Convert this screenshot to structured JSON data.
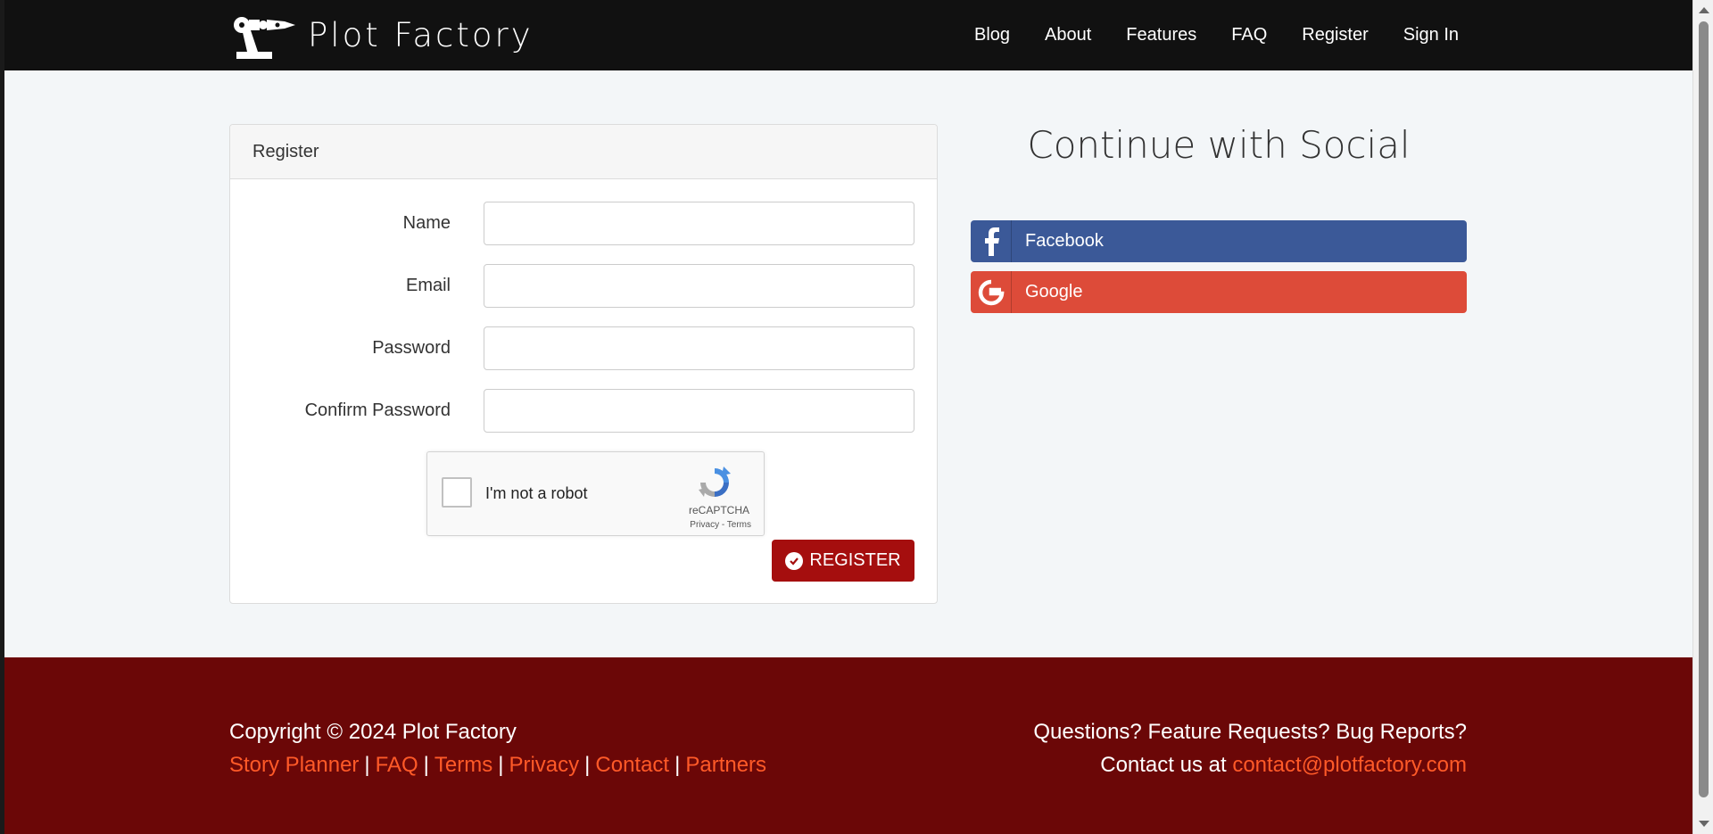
{
  "brand": {
    "name": "Plot Factory"
  },
  "nav": {
    "items": [
      {
        "label": "Blog"
      },
      {
        "label": "About"
      },
      {
        "label": "Features"
      },
      {
        "label": "FAQ"
      },
      {
        "label": "Register"
      },
      {
        "label": "Sign In"
      }
    ]
  },
  "register": {
    "header": "Register",
    "fields": [
      {
        "label": "Name",
        "value": ""
      },
      {
        "label": "Email",
        "value": ""
      },
      {
        "label": "Password",
        "value": ""
      },
      {
        "label": "Confirm Password",
        "value": ""
      }
    ],
    "captcha": {
      "text": "I'm not a robot",
      "brand": "reCAPTCHA",
      "links": "Privacy - Terms"
    },
    "submit_label": "REGISTER"
  },
  "social": {
    "title": "Continue with Social",
    "facebook": "Facebook",
    "google": "Google"
  },
  "footer": {
    "copyright": "Copyright © 2024 Plot Factory",
    "links": [
      "Story Planner",
      "FAQ",
      "Terms",
      "Privacy",
      "Contact",
      "Partners"
    ],
    "questions": "Questions? Feature Requests? Bug Reports?",
    "contact_prefix": "Contact us at ",
    "contact_email": "contact@plotfactory.com"
  },
  "colors": {
    "navbar": "#111111",
    "footer": "#6b0707",
    "accent_link": "#ff5a28",
    "register_button": "#a50e0e",
    "facebook": "#3b5998",
    "google": "#dd4b39"
  }
}
